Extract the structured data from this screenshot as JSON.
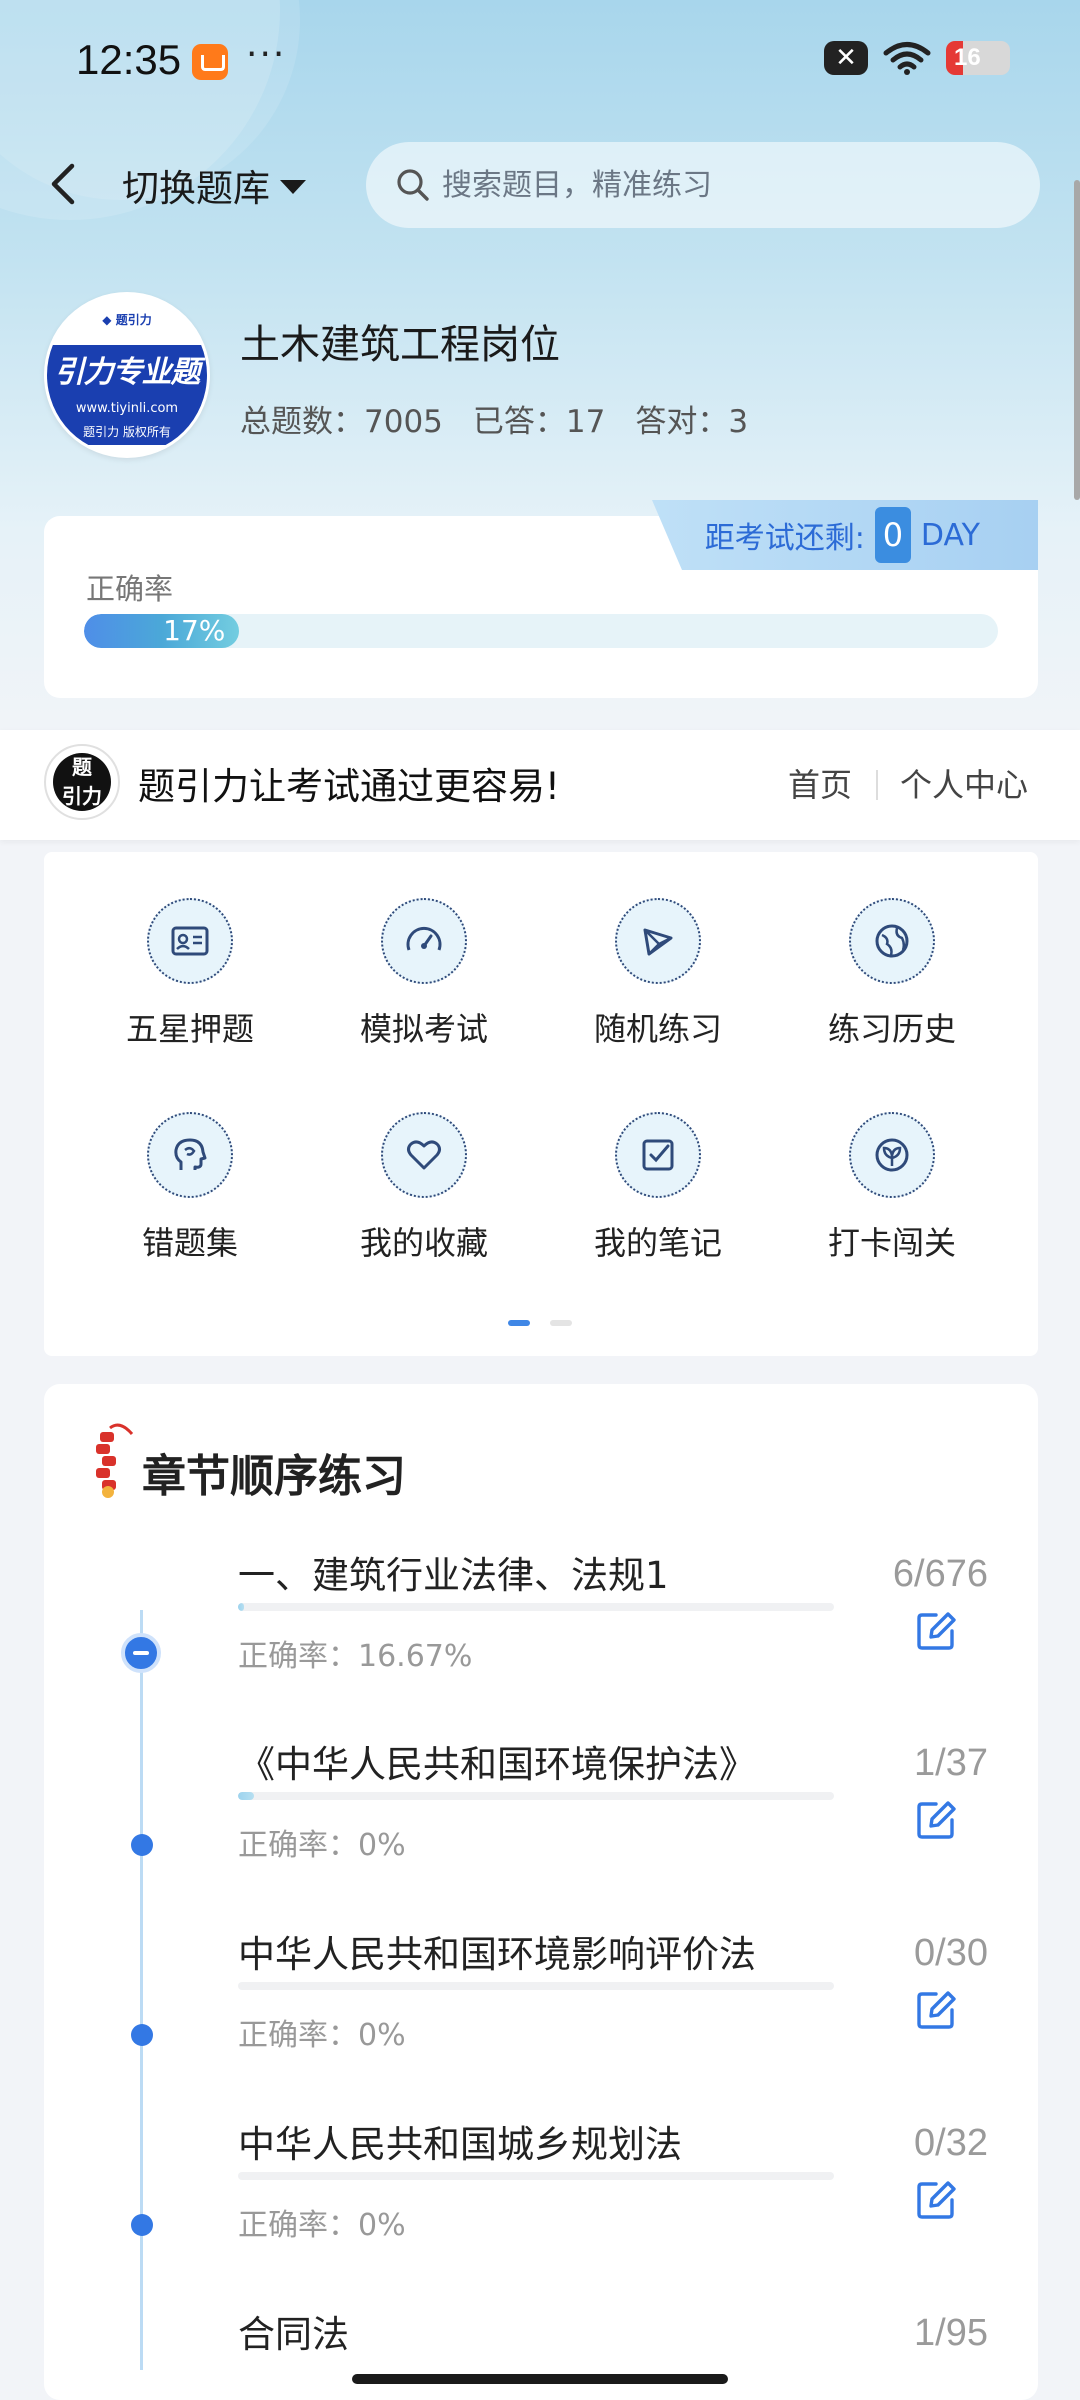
{
  "status_bar": {
    "time": "12:35",
    "battery": "16"
  },
  "header": {
    "switch_label": "切换题库",
    "search_placeholder": "搜索题目，精准练习"
  },
  "bank": {
    "logo_text": "引力专业题",
    "logo_url": "www.tiyinli.com",
    "logo_copyright": "题引力 版权所有",
    "title": "土木建筑工程岗位",
    "total_label": "总题数：7005",
    "answered_label": "已答：17",
    "correct_label": "答对：3"
  },
  "countdown": {
    "label": "距考试还剩:",
    "value": "0",
    "unit": "DAY"
  },
  "accuracy": {
    "label": "正确率",
    "value_text": "17%",
    "percent": 17
  },
  "brand": {
    "slogan": "题引力让考试通过更容易!",
    "nav_home": "首页",
    "nav_me": "个人中心"
  },
  "features": [
    {
      "label": "五星押题",
      "icon": "id-card-icon"
    },
    {
      "label": "模拟考试",
      "icon": "speedometer-icon"
    },
    {
      "label": "随机练习",
      "icon": "shuffle-icon"
    },
    {
      "label": "练习历史",
      "icon": "globe-icon"
    },
    {
      "label": "错题集",
      "icon": "head-icon"
    },
    {
      "label": "我的收藏",
      "icon": "heart-icon"
    },
    {
      "label": "我的笔记",
      "icon": "note-check-icon"
    },
    {
      "label": "打卡闯关",
      "icon": "leaf-icon"
    }
  ],
  "chapters": {
    "title": "章节顺序练习",
    "items": [
      {
        "name": "一、建筑行业法律、法规1",
        "accuracy": "正确率：16.67%",
        "count": "6/676",
        "progress": 0.009
      },
      {
        "name": "《中华人民共和国环境保护法》",
        "accuracy": "正确率：0%",
        "count": "1/37",
        "progress": 0.027
      },
      {
        "name": "中华人民共和国环境影响评价法",
        "accuracy": "正确率：0%",
        "count": "0/30",
        "progress": 0
      },
      {
        "name": "中华人民共和国城乡规划法",
        "accuracy": "正确率：0%",
        "count": "0/32",
        "progress": 0
      },
      {
        "name": "合同法",
        "accuracy": "",
        "count": "1/95",
        "progress": 0.01
      }
    ]
  },
  "colors": {
    "accent": "#3378e4",
    "progress": "#4f8ee8",
    "countdown_bg": "#bfe0f7"
  }
}
